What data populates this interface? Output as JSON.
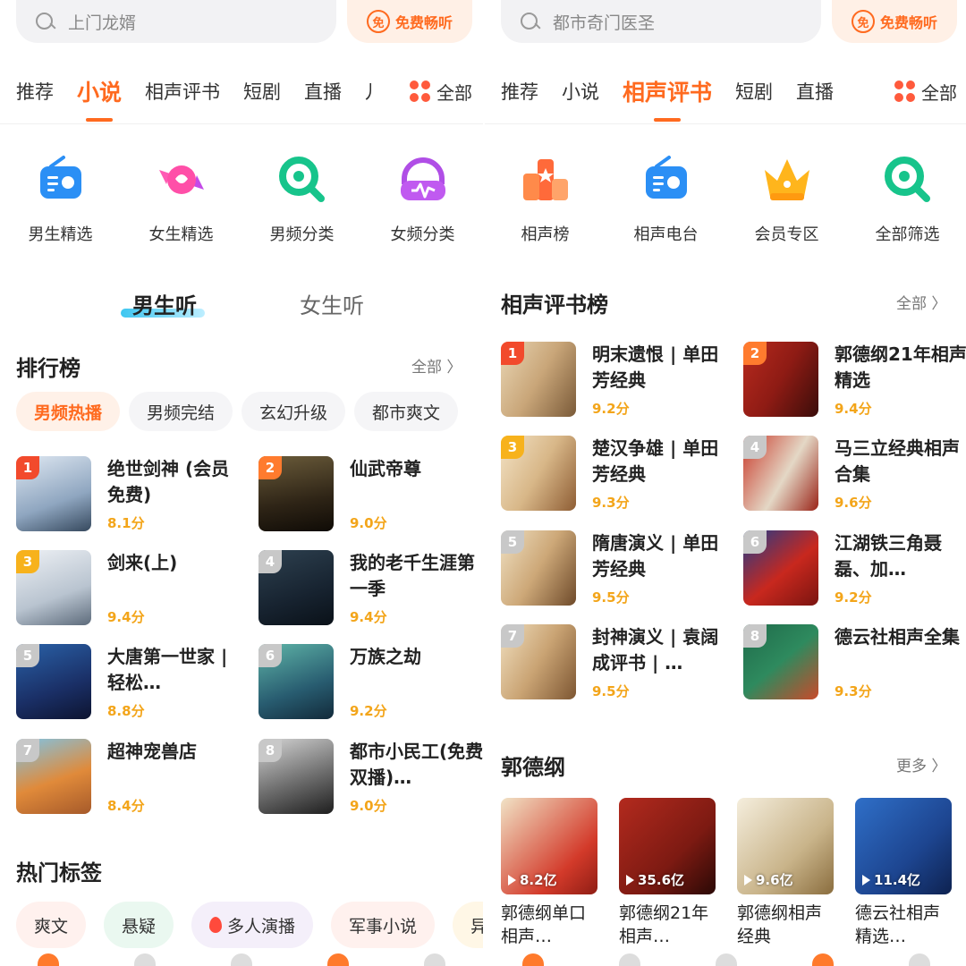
{
  "colors": {
    "accent": "#ff6a1f",
    "score": "#f3a51a",
    "chip_active_bg": "#fff1e8"
  },
  "left": {
    "search": {
      "placeholder": "上门龙婿"
    },
    "free_button": {
      "icon": "免",
      "label": "免费畅听"
    },
    "tabs": [
      {
        "label": "推荐",
        "active": false
      },
      {
        "label": "小说",
        "active": true
      },
      {
        "label": "相声评书",
        "active": false
      },
      {
        "label": "短剧",
        "active": false
      },
      {
        "label": "直播",
        "active": false
      },
      {
        "label": "儿",
        "active": false
      }
    ],
    "tab_all": "全部",
    "quick": [
      {
        "label": "男生精选",
        "icon": "radio-icon"
      },
      {
        "label": "女生精选",
        "icon": "candy-icon"
      },
      {
        "label": "男频分类",
        "icon": "search-category-icon"
      },
      {
        "label": "女频分类",
        "icon": "headphones-icon"
      }
    ],
    "subtabs": {
      "male": "男生听",
      "female": "女生听"
    },
    "rank": {
      "title": "排行榜",
      "more": "全部 〉",
      "chips": [
        "男频热播",
        "男频完结",
        "玄幻升级",
        "都市爽文"
      ],
      "items": [
        {
          "rank": "1",
          "title": "绝世剑神 (会员免费)",
          "score": "8.1分"
        },
        {
          "rank": "2",
          "title": "仙武帝尊",
          "score": "9.0分"
        },
        {
          "rank": "3",
          "title": "剑来(上)",
          "score": "9.4分"
        },
        {
          "rank": "4",
          "title": "我的老千生涯第一季",
          "score": "9.4分"
        },
        {
          "rank": "5",
          "title": "大唐第一世家 | 轻松…",
          "score": "8.8分"
        },
        {
          "rank": "6",
          "title": "万族之劫",
          "score": "9.2分"
        },
        {
          "rank": "7",
          "title": "超神宠兽店",
          "score": "8.4分"
        },
        {
          "rank": "8",
          "title": "都市小民工(免费双播)…",
          "score": "9.0分"
        }
      ]
    },
    "hot_tags": {
      "title": "热门标签",
      "items": [
        "爽文",
        "悬疑",
        "多人演播",
        "军事小说",
        "异"
      ]
    }
  },
  "right": {
    "search": {
      "placeholder": "都市奇门医圣"
    },
    "free_button": {
      "icon": "免",
      "label": "免费畅听"
    },
    "tabs": [
      {
        "label": "推荐",
        "active": false
      },
      {
        "label": "小说",
        "active": false
      },
      {
        "label": "相声评书",
        "active": true
      },
      {
        "label": "短剧",
        "active": false
      },
      {
        "label": "直播",
        "active": false
      }
    ],
    "tab_all": "全部",
    "quick": [
      {
        "label": "相声榜",
        "icon": "podium-icon"
      },
      {
        "label": "相声电台",
        "icon": "radio-icon"
      },
      {
        "label": "会员专区",
        "icon": "crown-icon"
      },
      {
        "label": "全部筛选",
        "icon": "search-filter-icon"
      }
    ],
    "rank": {
      "title": "相声评书榜",
      "more": "全部 〉",
      "items": [
        {
          "rank": "1",
          "title": "明末遗恨 | 单田芳经典",
          "score": "9.2分"
        },
        {
          "rank": "2",
          "title": "郭德纲21年相声精选",
          "score": "9.4分"
        },
        {
          "rank": "3",
          "title": "楚汉争雄 | 单田芳经典",
          "score": "9.3分"
        },
        {
          "rank": "4",
          "title": "马三立经典相声合集",
          "score": "9.6分"
        },
        {
          "rank": "5",
          "title": "隋唐演义 | 单田芳经典",
          "score": "9.5分"
        },
        {
          "rank": "6",
          "title": "江湖铁三角聂磊、加…",
          "score": "9.2分"
        },
        {
          "rank": "7",
          "title": "封神演义 | 袁阔成评书 | …",
          "score": "9.5分"
        },
        {
          "rank": "8",
          "title": "德云社相声全集",
          "score": "9.3分"
        }
      ]
    },
    "guodegang": {
      "title": "郭德纲",
      "more": "更多 〉",
      "items": [
        {
          "plays": "8.2亿",
          "title": "郭德纲单口相声…"
        },
        {
          "plays": "35.6亿",
          "title": "郭德纲21年相声…"
        },
        {
          "plays": "9.6亿",
          "title": "郭德纲相声经典"
        },
        {
          "plays": "11.4亿",
          "title": "德云社相声精选…"
        }
      ]
    }
  }
}
